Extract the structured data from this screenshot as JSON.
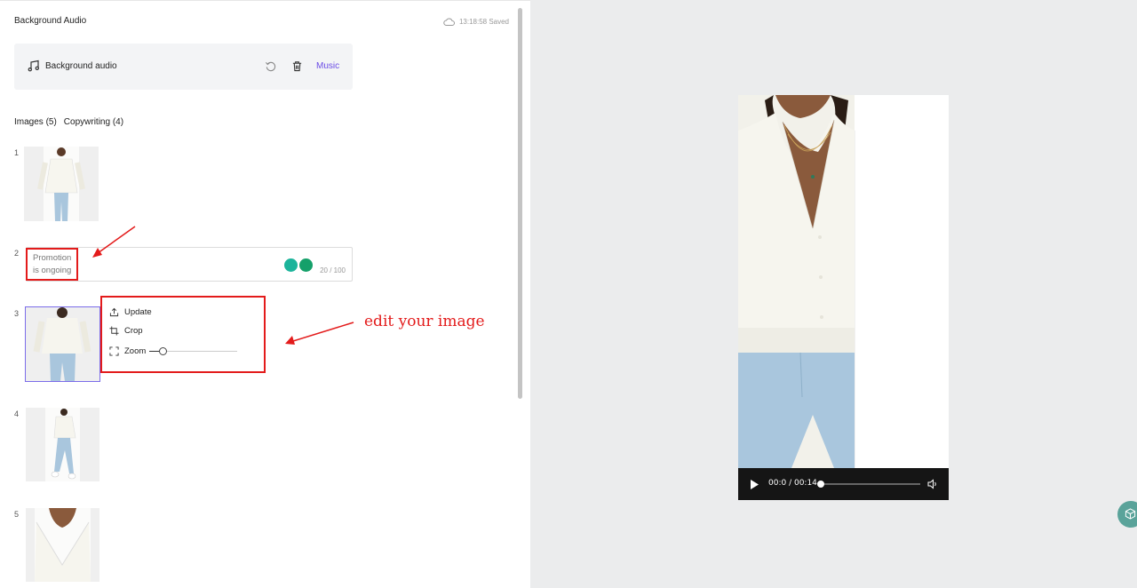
{
  "header": {
    "title": "Background Audio",
    "saved_status": "13:18:58 Saved"
  },
  "audio": {
    "label": "Background audio",
    "music_link": "Music"
  },
  "tabs": [
    {
      "label": "Images (5)"
    },
    {
      "label": "Copywriting (4)"
    }
  ],
  "rows": [
    {
      "number": "1"
    },
    {
      "number": "2",
      "copy_text": "Promotion is ongoing",
      "char_count": "20 / 100"
    },
    {
      "number": "3"
    },
    {
      "number": "4"
    },
    {
      "number": "5"
    }
  ],
  "image_menu": {
    "items": [
      {
        "label": "Update"
      },
      {
        "label": "Crop"
      },
      {
        "label": "Zoom"
      }
    ],
    "zoom_level": 0.15
  },
  "annotation": {
    "text": "edit your image"
  },
  "player": {
    "time": "00:0 / 00:14",
    "progress": 0.0
  },
  "colors": {
    "accent": "#6b4ce6",
    "annotation": "#e31b1b",
    "panel_bg": "#ebeced"
  }
}
